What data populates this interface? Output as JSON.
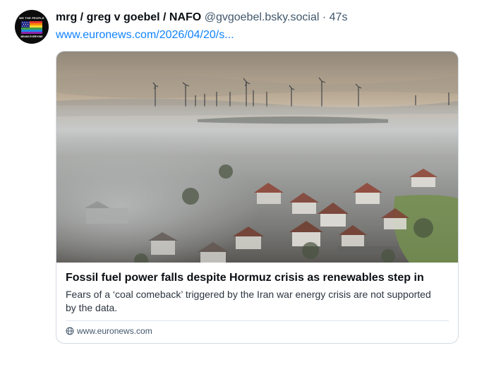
{
  "author": {
    "display_name": "mrg / greg v goebel / NAFO",
    "handle": "@gvgoebel.bsky.social",
    "separator": "·",
    "time_ago": "47s",
    "avatar": {
      "top_text": "WE THE PEOPLE",
      "bottom_text": "MEANS EVERYONE",
      "icon": "american-flag-rainbow"
    }
  },
  "post": {
    "link_text": "www.euronews.com/2026/04/20/s..."
  },
  "card": {
    "image_description_icon": "landscape-photo",
    "title": "Fossil fuel power falls despite Hormuz crisis as renewables step in",
    "description": "Fears of a ‘coal comeback’ triggered by the Iran war energy crisis are not supported by the data.",
    "source_icon": "globe-icon",
    "source": "www.euronews.com"
  },
  "colors": {
    "link": "#1083fe",
    "muted": "#42576c",
    "border": "#d4dbe2"
  }
}
